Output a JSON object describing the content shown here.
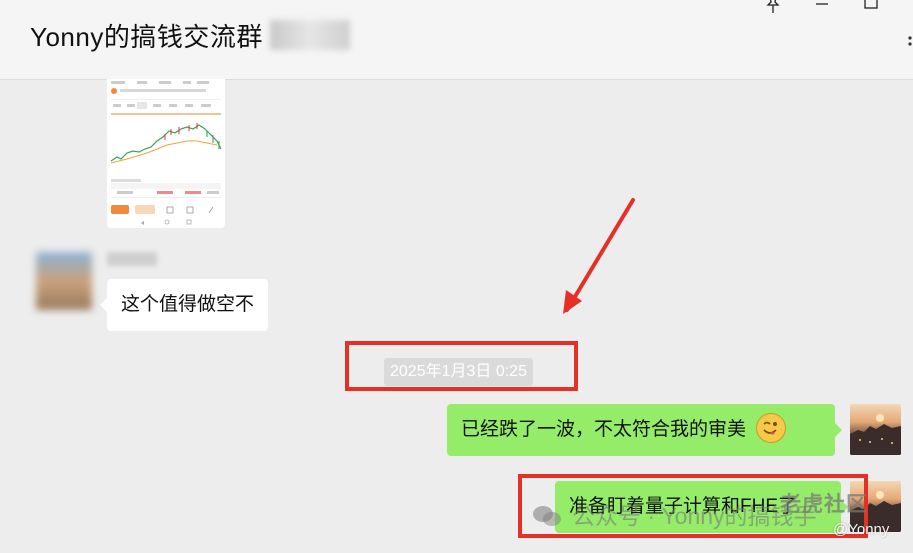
{
  "window": {
    "title": "Yonny的搞钱交流群",
    "pin_icon": "pin-icon",
    "minimize_icon": "minimize-icon",
    "maximize_icon": "maximize-icon",
    "more_icon": "more-vertical-icon"
  },
  "messages": [
    {
      "id": "m1",
      "side": "left",
      "type": "image",
      "content": "stock chart screenshot"
    },
    {
      "id": "m2",
      "side": "left",
      "type": "text",
      "text": "这个值得做空不"
    },
    {
      "id": "m3",
      "type": "timestamp",
      "text": "2025年1月3日 0:25"
    },
    {
      "id": "m4",
      "side": "right",
      "type": "text",
      "text": "已经跌了一波，不太符合我的审美",
      "emoji": "wink-tongue-emoji"
    },
    {
      "id": "m5",
      "side": "right",
      "type": "text",
      "text": "准备盯着量子计算和FHE了"
    }
  ],
  "watermark": {
    "text": "公众号 · Yonny的搞钱手",
    "logo_text": "老虎社区",
    "handle": "@Yonny"
  },
  "colors": {
    "background": "#ededed",
    "bubble_self": "#95ec69",
    "bubble_other": "#ffffff",
    "highlight": "#e53028"
  }
}
